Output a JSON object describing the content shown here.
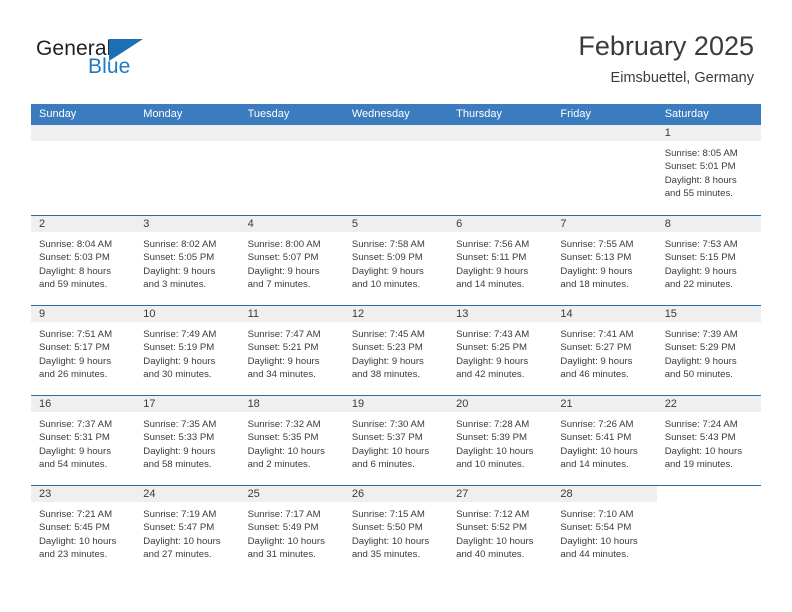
{
  "brand": {
    "name_part1": "General",
    "name_part2": "Blue",
    "flag_icon": "triangle-flag-icon"
  },
  "header": {
    "title": "February 2025",
    "subtitle": "Eimsbuettel, Germany"
  },
  "colors": {
    "header_blue": "#3a7cbe",
    "row_divider": "#2e6da4",
    "day_head_gray": "#efefef",
    "text": "#3b3b3b",
    "brand_blue": "#1f7ac4"
  },
  "weekdays": [
    "Sunday",
    "Monday",
    "Tuesday",
    "Wednesday",
    "Thursday",
    "Friday",
    "Saturday"
  ],
  "weeks": [
    {
      "days": [
        {
          "state": "blank"
        },
        {
          "state": "blank"
        },
        {
          "state": "blank"
        },
        {
          "state": "blank"
        },
        {
          "state": "blank"
        },
        {
          "state": "blank"
        },
        {
          "state": "filled",
          "num": "1",
          "l1": "Sunrise: 8:05 AM",
          "l2": "Sunset: 5:01 PM",
          "l3": "Daylight: 8 hours",
          "l4": "and 55 minutes."
        }
      ]
    },
    {
      "days": [
        {
          "state": "filled",
          "num": "2",
          "l1": "Sunrise: 8:04 AM",
          "l2": "Sunset: 5:03 PM",
          "l3": "Daylight: 8 hours",
          "l4": "and 59 minutes."
        },
        {
          "state": "filled",
          "num": "3",
          "l1": "Sunrise: 8:02 AM",
          "l2": "Sunset: 5:05 PM",
          "l3": "Daylight: 9 hours",
          "l4": "and 3 minutes."
        },
        {
          "state": "filled",
          "num": "4",
          "l1": "Sunrise: 8:00 AM",
          "l2": "Sunset: 5:07 PM",
          "l3": "Daylight: 9 hours",
          "l4": "and 7 minutes."
        },
        {
          "state": "filled",
          "num": "5",
          "l1": "Sunrise: 7:58 AM",
          "l2": "Sunset: 5:09 PM",
          "l3": "Daylight: 9 hours",
          "l4": "and 10 minutes."
        },
        {
          "state": "filled",
          "num": "6",
          "l1": "Sunrise: 7:56 AM",
          "l2": "Sunset: 5:11 PM",
          "l3": "Daylight: 9 hours",
          "l4": "and 14 minutes."
        },
        {
          "state": "filled",
          "num": "7",
          "l1": "Sunrise: 7:55 AM",
          "l2": "Sunset: 5:13 PM",
          "l3": "Daylight: 9 hours",
          "l4": "and 18 minutes."
        },
        {
          "state": "filled",
          "num": "8",
          "l1": "Sunrise: 7:53 AM",
          "l2": "Sunset: 5:15 PM",
          "l3": "Daylight: 9 hours",
          "l4": "and 22 minutes."
        }
      ]
    },
    {
      "days": [
        {
          "state": "filled",
          "num": "9",
          "l1": "Sunrise: 7:51 AM",
          "l2": "Sunset: 5:17 PM",
          "l3": "Daylight: 9 hours",
          "l4": "and 26 minutes."
        },
        {
          "state": "filled",
          "num": "10",
          "l1": "Sunrise: 7:49 AM",
          "l2": "Sunset: 5:19 PM",
          "l3": "Daylight: 9 hours",
          "l4": "and 30 minutes."
        },
        {
          "state": "filled",
          "num": "11",
          "l1": "Sunrise: 7:47 AM",
          "l2": "Sunset: 5:21 PM",
          "l3": "Daylight: 9 hours",
          "l4": "and 34 minutes."
        },
        {
          "state": "filled",
          "num": "12",
          "l1": "Sunrise: 7:45 AM",
          "l2": "Sunset: 5:23 PM",
          "l3": "Daylight: 9 hours",
          "l4": "and 38 minutes."
        },
        {
          "state": "filled",
          "num": "13",
          "l1": "Sunrise: 7:43 AM",
          "l2": "Sunset: 5:25 PM",
          "l3": "Daylight: 9 hours",
          "l4": "and 42 minutes."
        },
        {
          "state": "filled",
          "num": "14",
          "l1": "Sunrise: 7:41 AM",
          "l2": "Sunset: 5:27 PM",
          "l3": "Daylight: 9 hours",
          "l4": "and 46 minutes."
        },
        {
          "state": "filled",
          "num": "15",
          "l1": "Sunrise: 7:39 AM",
          "l2": "Sunset: 5:29 PM",
          "l3": "Daylight: 9 hours",
          "l4": "and 50 minutes."
        }
      ]
    },
    {
      "days": [
        {
          "state": "filled",
          "num": "16",
          "l1": "Sunrise: 7:37 AM",
          "l2": "Sunset: 5:31 PM",
          "l3": "Daylight: 9 hours",
          "l4": "and 54 minutes."
        },
        {
          "state": "filled",
          "num": "17",
          "l1": "Sunrise: 7:35 AM",
          "l2": "Sunset: 5:33 PM",
          "l3": "Daylight: 9 hours",
          "l4": "and 58 minutes."
        },
        {
          "state": "filled",
          "num": "18",
          "l1": "Sunrise: 7:32 AM",
          "l2": "Sunset: 5:35 PM",
          "l3": "Daylight: 10 hours",
          "l4": "and 2 minutes."
        },
        {
          "state": "filled",
          "num": "19",
          "l1": "Sunrise: 7:30 AM",
          "l2": "Sunset: 5:37 PM",
          "l3": "Daylight: 10 hours",
          "l4": "and 6 minutes."
        },
        {
          "state": "filled",
          "num": "20",
          "l1": "Sunrise: 7:28 AM",
          "l2": "Sunset: 5:39 PM",
          "l3": "Daylight: 10 hours",
          "l4": "and 10 minutes."
        },
        {
          "state": "filled",
          "num": "21",
          "l1": "Sunrise: 7:26 AM",
          "l2": "Sunset: 5:41 PM",
          "l3": "Daylight: 10 hours",
          "l4": "and 14 minutes."
        },
        {
          "state": "filled",
          "num": "22",
          "l1": "Sunrise: 7:24 AM",
          "l2": "Sunset: 5:43 PM",
          "l3": "Daylight: 10 hours",
          "l4": "and 19 minutes."
        }
      ]
    },
    {
      "days": [
        {
          "state": "filled",
          "num": "23",
          "l1": "Sunrise: 7:21 AM",
          "l2": "Sunset: 5:45 PM",
          "l3": "Daylight: 10 hours",
          "l4": "and 23 minutes."
        },
        {
          "state": "filled",
          "num": "24",
          "l1": "Sunrise: 7:19 AM",
          "l2": "Sunset: 5:47 PM",
          "l3": "Daylight: 10 hours",
          "l4": "and 27 minutes."
        },
        {
          "state": "filled",
          "num": "25",
          "l1": "Sunrise: 7:17 AM",
          "l2": "Sunset: 5:49 PM",
          "l3": "Daylight: 10 hours",
          "l4": "and 31 minutes."
        },
        {
          "state": "filled",
          "num": "26",
          "l1": "Sunrise: 7:15 AM",
          "l2": "Sunset: 5:50 PM",
          "l3": "Daylight: 10 hours",
          "l4": "and 35 minutes."
        },
        {
          "state": "filled",
          "num": "27",
          "l1": "Sunrise: 7:12 AM",
          "l2": "Sunset: 5:52 PM",
          "l3": "Daylight: 10 hours",
          "l4": "and 40 minutes."
        },
        {
          "state": "filled",
          "num": "28",
          "l1": "Sunrise: 7:10 AM",
          "l2": "Sunset: 5:54 PM",
          "l3": "Daylight: 10 hours",
          "l4": "and 44 minutes."
        },
        {
          "state": "empty"
        }
      ]
    }
  ]
}
